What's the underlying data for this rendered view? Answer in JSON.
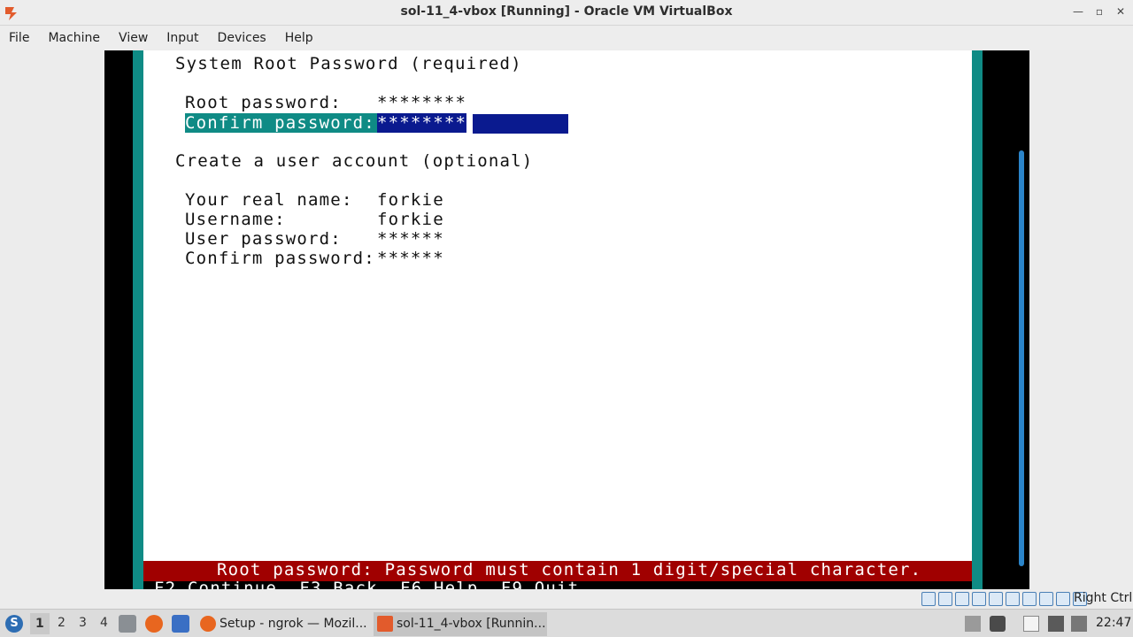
{
  "window": {
    "title": "sol-11_4-vbox [Running] - Oracle VM VirtualBox",
    "controls": [
      "minimize",
      "restore",
      "close"
    ]
  },
  "menu": [
    "File",
    "Machine",
    "View",
    "Input",
    "Devices",
    "Help"
  ],
  "installer": {
    "root_section_title": "System Root Password (required)",
    "root_password_label": "Root password:",
    "root_password_value": "********",
    "confirm_root_label": "Confirm password:",
    "confirm_root_value": "********",
    "user_section_title": "Create a user account (optional)",
    "real_name_label": "Your real name:",
    "real_name_value": "forkie",
    "username_label": "Username:",
    "username_value": "forkie",
    "user_password_label": "User password:",
    "user_password_value": "******",
    "confirm_user_label": "Confirm password:",
    "confirm_user_value": "******",
    "error_message": "Root password: Password must contain 1 digit/special character.",
    "function_keys": "F2_Continue  F3_Back  F6_Help  F9_Quit"
  },
  "statusbar": {
    "host_key": "Right Ctrl"
  },
  "taskbar": {
    "workspaces": [
      "1",
      "2",
      "3",
      "4"
    ],
    "active_workspace": "1",
    "tasks": [
      {
        "label": "Setup - ngrok — Mozil..."
      },
      {
        "label": "sol-11_4-vbox [Runnin..."
      }
    ],
    "clock": "22:47"
  },
  "colors": {
    "teal": "#0f8b85",
    "error_red": "#a00000",
    "field_blue": "#0a1a8f"
  }
}
